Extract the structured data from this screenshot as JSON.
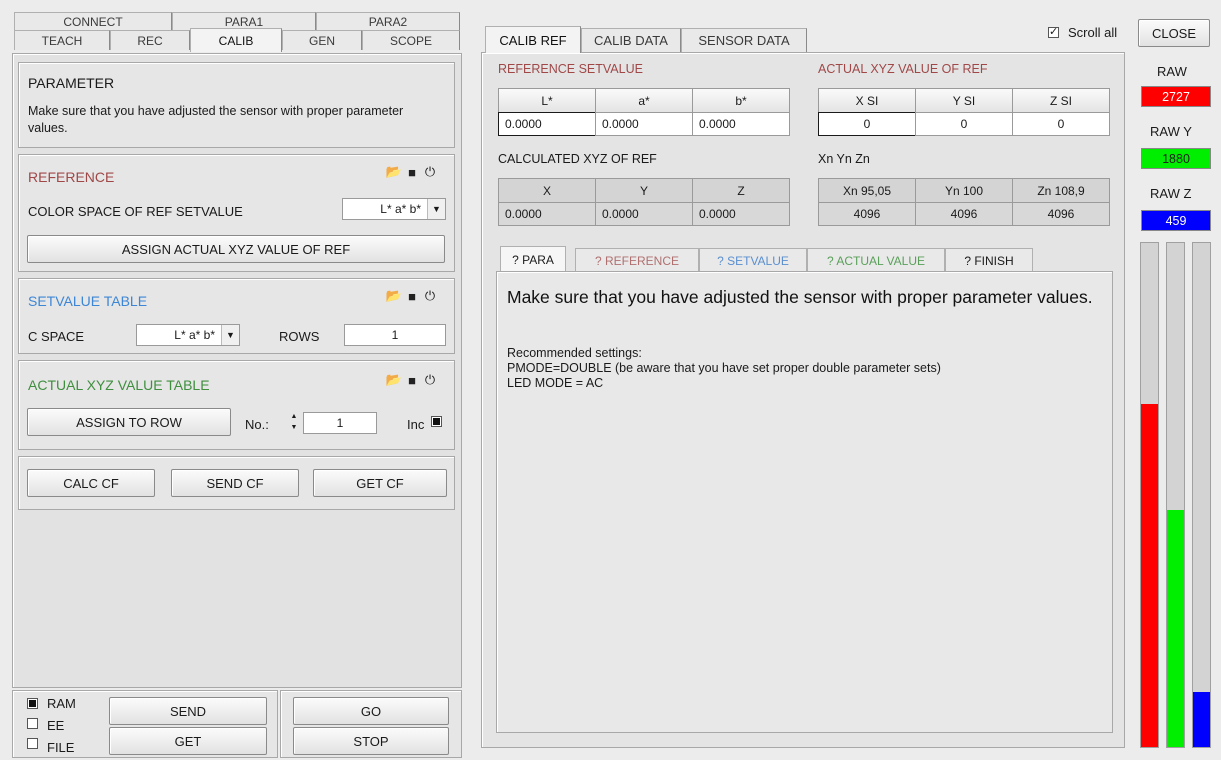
{
  "left_tabs": {
    "row1": [
      "CONNECT",
      "PARA1",
      "PARA2"
    ],
    "row2": [
      "TEACH",
      "REC",
      "CALIB",
      "GEN",
      "SCOPE"
    ]
  },
  "parameter": {
    "title": "PARAMETER",
    "text": "Make sure that you have adjusted the sensor with proper parameter values."
  },
  "reference": {
    "title": "REFERENCE",
    "color_space_label": "COLOR SPACE OF REF SETVALUE",
    "color_space_value": "L* a* b*",
    "assign_button": "ASSIGN ACTUAL XYZ VALUE OF REF"
  },
  "setvalue_table": {
    "title": "SETVALUE TABLE",
    "cspace_label": "C SPACE",
    "cspace_value": "L* a* b*",
    "rows_label": "ROWS",
    "rows_value": "1"
  },
  "actual_table": {
    "title": "ACTUAL XYZ VALUE TABLE",
    "assign_button": "ASSIGN TO ROW",
    "no_label": "No.:",
    "no_value": "1",
    "inc_label": "Inc"
  },
  "calc_buttons": [
    "CALC CF",
    "SEND CF",
    "GET CF"
  ],
  "bottom": {
    "options": [
      "RAM",
      "EE",
      "FILE"
    ],
    "selected_option": "RAM",
    "send": "SEND",
    "get": "GET",
    "go": "GO",
    "stop": "STOP"
  },
  "right_tabs": [
    "CALIB REF",
    "CALIB DATA",
    "SENSOR DATA"
  ],
  "scroll_all": "Scroll all",
  "close": "CLOSE",
  "reference_setvalue": {
    "title": "REFERENCE SETVALUE",
    "headers": [
      "L*",
      "a*",
      "b*"
    ],
    "values": [
      "0.0000",
      "0.0000",
      "0.0000"
    ]
  },
  "actual_xyz": {
    "title": "ACTUAL XYZ VALUE OF REF",
    "headers": [
      "X SI",
      "Y SI",
      "Z SI"
    ],
    "values": [
      "0",
      "0",
      "0"
    ]
  },
  "calculated_xyz": {
    "title": "CALCULATED XYZ  OF REF",
    "headers": [
      "X",
      "Y",
      "Z"
    ],
    "values": [
      "0.0000",
      "0.0000",
      "0.0000"
    ]
  },
  "xn_yn_zn": {
    "title": "Xn Yn Zn",
    "headers": [
      "Xn 95,05",
      "Yn 100",
      "Zn 108,9"
    ],
    "values": [
      "4096",
      "4096",
      "4096"
    ]
  },
  "help_tabs": [
    "? PARA",
    "? REFERENCE",
    "? SETVALUE",
    "? ACTUAL VALUE",
    "? FINISH"
  ],
  "help_tab_colors": [
    "#1a1a1a",
    "#b07070",
    "#5a8fd0",
    "#5aa05a",
    "#1a1a1a"
  ],
  "help": {
    "main": "Make sure that you have adjusted the sensor with proper parameter values.",
    "line1": "Recommended settings:",
    "line2": "PMODE=DOUBLE (be aware that you have set proper double parameter sets)",
    "line3": "LED MODE = AC"
  },
  "raw": {
    "raw_label": "RAW",
    "raw_value": "2727",
    "rawy_label": "RAW Y",
    "rawy_value": "1880",
    "rawz_label": "RAW Z",
    "rawz_value": "459",
    "red_level": 0.68,
    "green_level": 0.47,
    "blue_level": 0.11
  },
  "colors": {
    "reference_title": "#a04848",
    "setvalue_title": "#3d86d6",
    "actual_title": "#3f8f3f",
    "ref_setvalue_title": "#a04848",
    "raw_red": "#ff0000",
    "raw_green": "#00ee00",
    "raw_blue": "#0000ff"
  }
}
